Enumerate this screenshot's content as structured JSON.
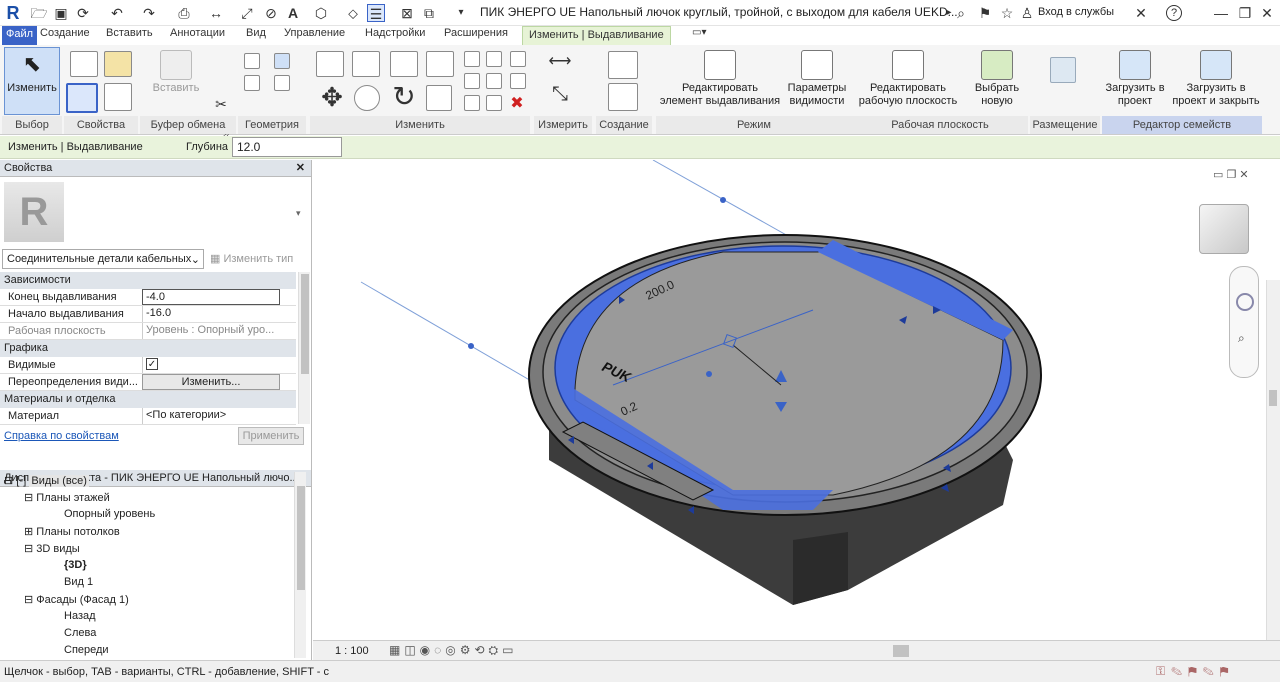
{
  "app": {
    "logo": "R",
    "title": "ПИК ЭНЕРГО UE Напольный лючок круглый, тройной, с выходом для кабеля UEKD...",
    "signin": "Вход в службы",
    "help": "?"
  },
  "tabs": [
    "Файл",
    "Создание",
    "Вставить",
    "Аннотации",
    "Вид",
    "Управление",
    "Надстройки",
    "Расширения",
    "Изменить | Выдавливание"
  ],
  "ribbon": {
    "groups": {
      "select": "Выбор",
      "properties": "Свойства",
      "clipboard": "Буфер обмена",
      "geometry": "Геометрия",
      "modify": "Изменить",
      "measure": "Измерить",
      "create": "Создание",
      "mode": "Режим",
      "workplane": "Рабочая плоскость",
      "placement": "Размещение",
      "family_editor": "Редактор семейств"
    },
    "buttons": {
      "modify": "Изменить",
      "paste": "Вставить",
      "edit_extrusion_1": "Редактировать",
      "edit_extrusion_2": "элемент выдавливания",
      "visibility_1": "Параметры",
      "visibility_2": "видимости",
      "edit_workplane_1": "Редактировать",
      "edit_workplane_2": "рабочую плоскость",
      "pick_new_1": "Выбрать",
      "pick_new_2": "новую",
      "load_project_1": "Загрузить в",
      "load_project_2": "проект",
      "load_close_1": "Загрузить в",
      "load_close_2": "проект и закрыть"
    }
  },
  "options": {
    "context": "Изменить | Выдавливание",
    "depth_label": "Глубина",
    "depth_value": "12.0"
  },
  "properties": {
    "header": "Свойства",
    "type_selector": "Соединительные детали кабельных",
    "edit_type": "Изменить тип",
    "sections": {
      "constraints": "Зависимости",
      "graphics": "Графика",
      "materials": "Материалы и отделка"
    },
    "rows": [
      {
        "k": "Конец выдавливания",
        "v": "-4.0"
      },
      {
        "k": "Начало выдавливания",
        "v": "-16.0"
      },
      {
        "k": "Рабочая плоскость",
        "v": "Уровень : Опорный уро..."
      },
      {
        "k": "Видимые",
        "v": "✓"
      },
      {
        "k": "Переопределения види...",
        "v": "Изменить..."
      },
      {
        "k": "Материал",
        "v": "<По категории>"
      }
    ],
    "help_link": "Справка по свойствам",
    "apply": "Применить"
  },
  "browser": {
    "header": "Диспетчер проекта - ПИК ЭНЕРГО UE Напольный лючо...",
    "items": [
      "Виды (все)",
      "Планы этажей",
      "Опорный уровень",
      "Планы потолков",
      "3D виды",
      "{3D}",
      "Вид 1",
      "Фасады (Фасад 1)",
      "Назад",
      "Слева",
      "Спереди"
    ]
  },
  "viewport": {
    "engraving": "PUK",
    "dim1": "200.0",
    "dim2": "0.2"
  },
  "viewbar": {
    "scale": "1 : 100"
  },
  "status": {
    "text": "Щелчок - выбор, TAB - варианты, CTRL - добавление, SHIFT - с"
  },
  "colors": {
    "accent": "#3a63c7",
    "selection": "#4a6fe0",
    "options_bg": "#e9f3dc"
  }
}
